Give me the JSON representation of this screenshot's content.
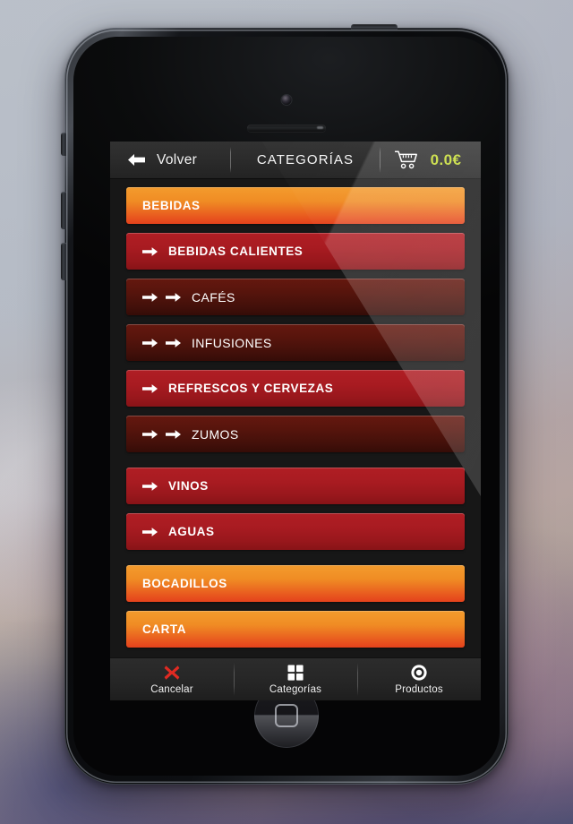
{
  "device": {
    "name": "smartphone-mockup",
    "camera": "front-camera",
    "earpiece": "earpiece-speaker",
    "home_button": "home-button"
  },
  "navbar": {
    "back_icon": "arrow-left-icon",
    "back_label": "Volver",
    "title": "CATEGORÍAS",
    "cart_icon": "shopping-cart-icon",
    "cart_total": "0.0€",
    "cart_total_color": "#c4da33"
  },
  "colors": {
    "level1_top": "#f39b2d",
    "level1_bottom": "#e4411c",
    "level2_top": "#b01e24",
    "level2_bottom": "#881317",
    "level3_top": "#65180f",
    "level3_bottom": "#350c07",
    "screen_bg": "#171717",
    "navbar_bg": "#2b2b2b",
    "cart_accent": "#c4da33",
    "cancel_red": "#e02a22"
  },
  "categories": [
    {
      "label": "BEBIDAS",
      "level": 1,
      "arrows": 0,
      "gap_after": false
    },
    {
      "label": "BEBIDAS CALIENTES",
      "level": 2,
      "arrows": 1,
      "gap_after": false
    },
    {
      "label": "CAFÉS",
      "level": 3,
      "arrows": 2,
      "gap_after": false
    },
    {
      "label": "INFUSIONES",
      "level": 3,
      "arrows": 2,
      "gap_after": false
    },
    {
      "label": "REFRESCOS Y CERVEZAS",
      "level": 2,
      "arrows": 1,
      "gap_after": false
    },
    {
      "label": "ZUMOS",
      "level": 3,
      "arrows": 2,
      "gap_after": true
    },
    {
      "label": "VINOS",
      "level": 2,
      "arrows": 1,
      "gap_after": false
    },
    {
      "label": "AGUAS",
      "level": 2,
      "arrows": 1,
      "gap_after": true
    },
    {
      "label": "BOCADILLOS",
      "level": 1,
      "arrows": 0,
      "gap_after": false
    },
    {
      "label": "CARTA",
      "level": 1,
      "arrows": 0,
      "gap_after": false
    }
  ],
  "tabbar": [
    {
      "label": "Cancelar",
      "icon": "cross-icon"
    },
    {
      "label": "Categorías",
      "icon": "grid-squares-icon"
    },
    {
      "label": "Productos",
      "icon": "circle-ring-icon"
    }
  ]
}
